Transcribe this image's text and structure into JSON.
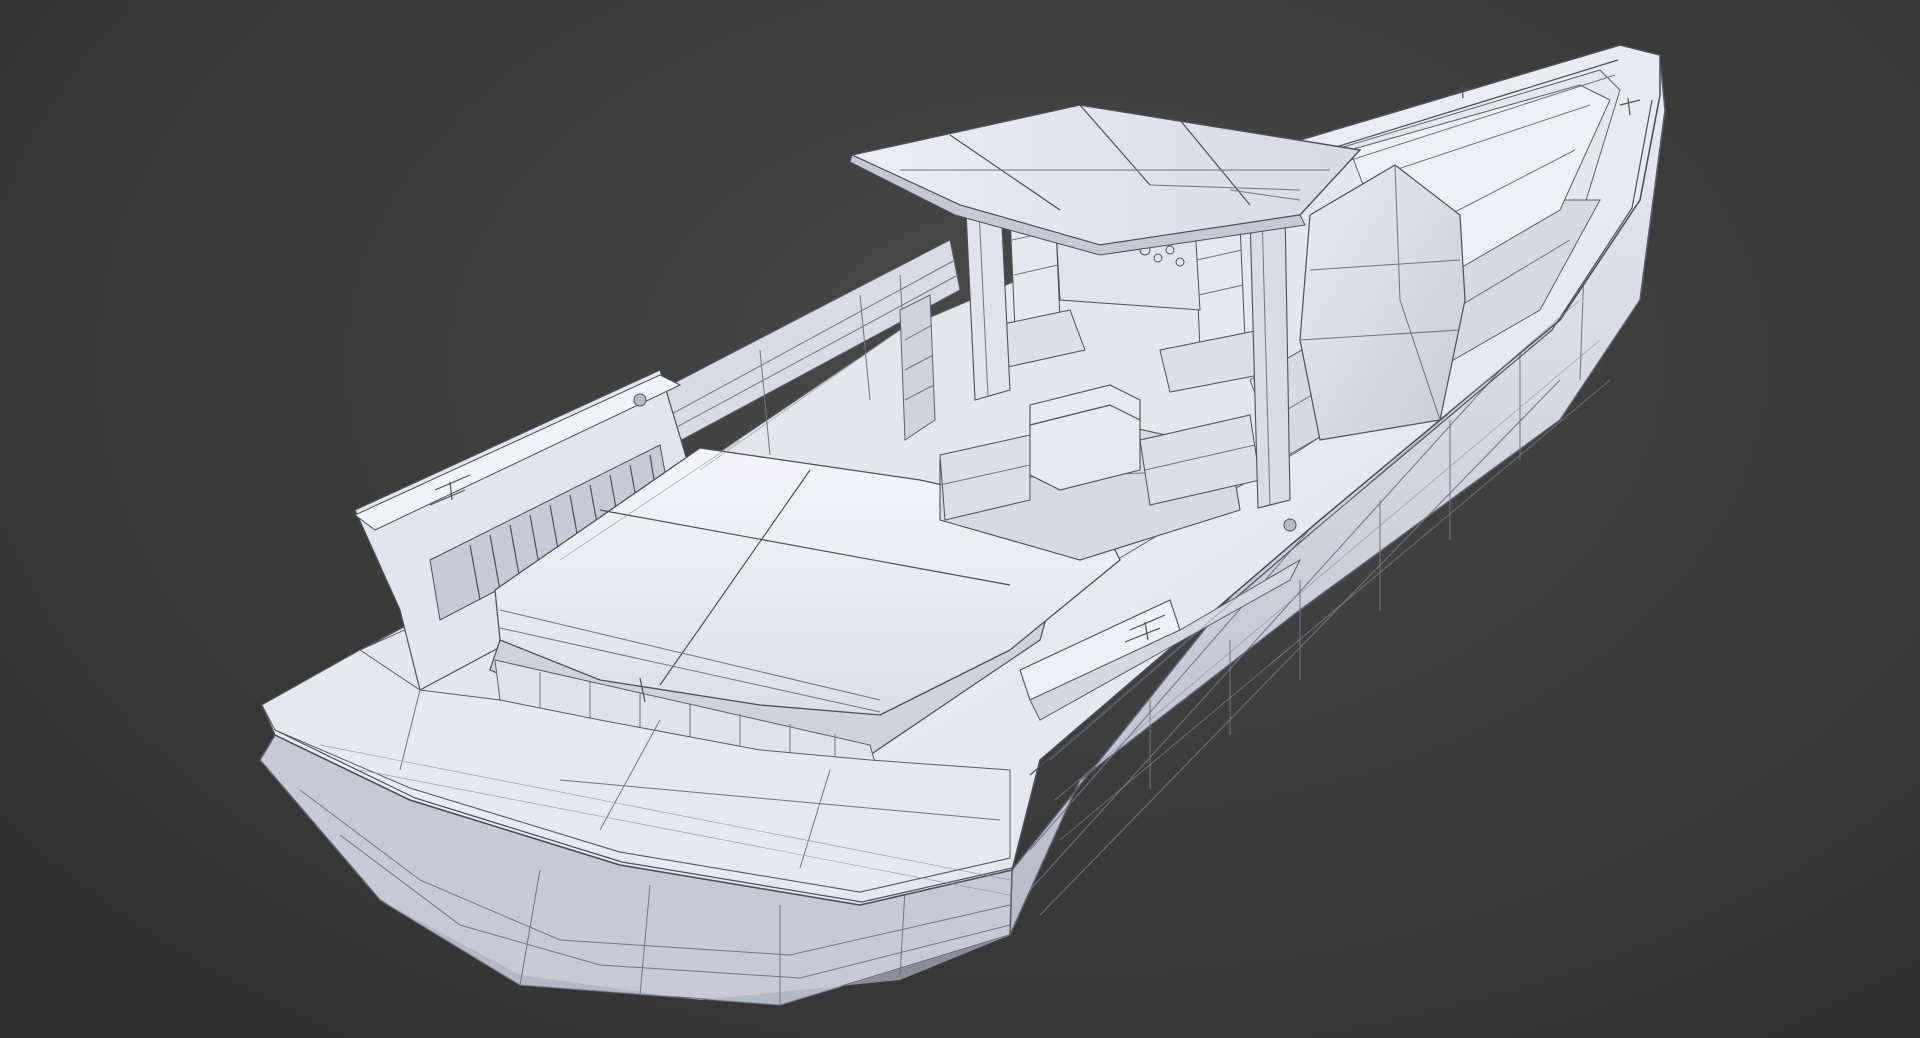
{
  "scene": {
    "subject": "center-console-boat-wireframe",
    "colors": {
      "background_center": "#4a4a4a",
      "background_edge": "#2f2f2f",
      "hull_light": "#eef0f7",
      "hull_mid": "#d9dce6",
      "hull_shadow": "#b9bdca",
      "wire": "#6f7486",
      "wire_dark": "#4b4f5e"
    }
  }
}
